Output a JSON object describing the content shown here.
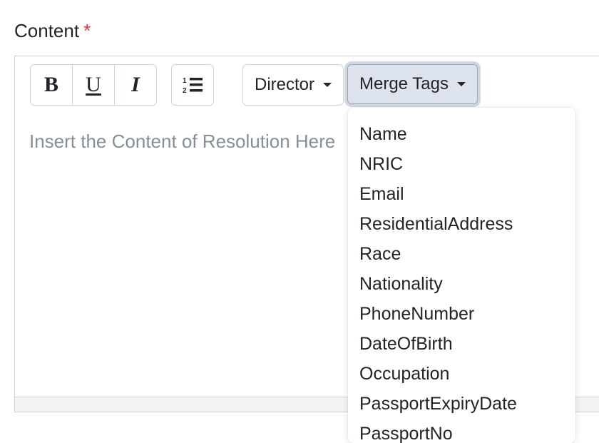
{
  "field": {
    "label": "Content",
    "required_marker": "*"
  },
  "toolbar": {
    "bold_label": "B",
    "underline_label": "U",
    "italic_label": "I",
    "director_label": "Director",
    "merge_tags_label": "Merge Tags"
  },
  "editor": {
    "placeholder": "Insert the Content of Resolution Here"
  },
  "merge_tags": {
    "items": [
      "Name",
      "NRIC",
      "Email",
      "ResidentialAddress",
      "Race",
      "Nationality",
      "PhoneNumber",
      "DateOfBirth",
      "Occupation",
      "PassportExpiryDate",
      "PassportNo"
    ]
  },
  "colors": {
    "required": "#dc3545",
    "border": "#cfd4da",
    "active_button": "#dde3ec",
    "placeholder": "#868e96"
  }
}
